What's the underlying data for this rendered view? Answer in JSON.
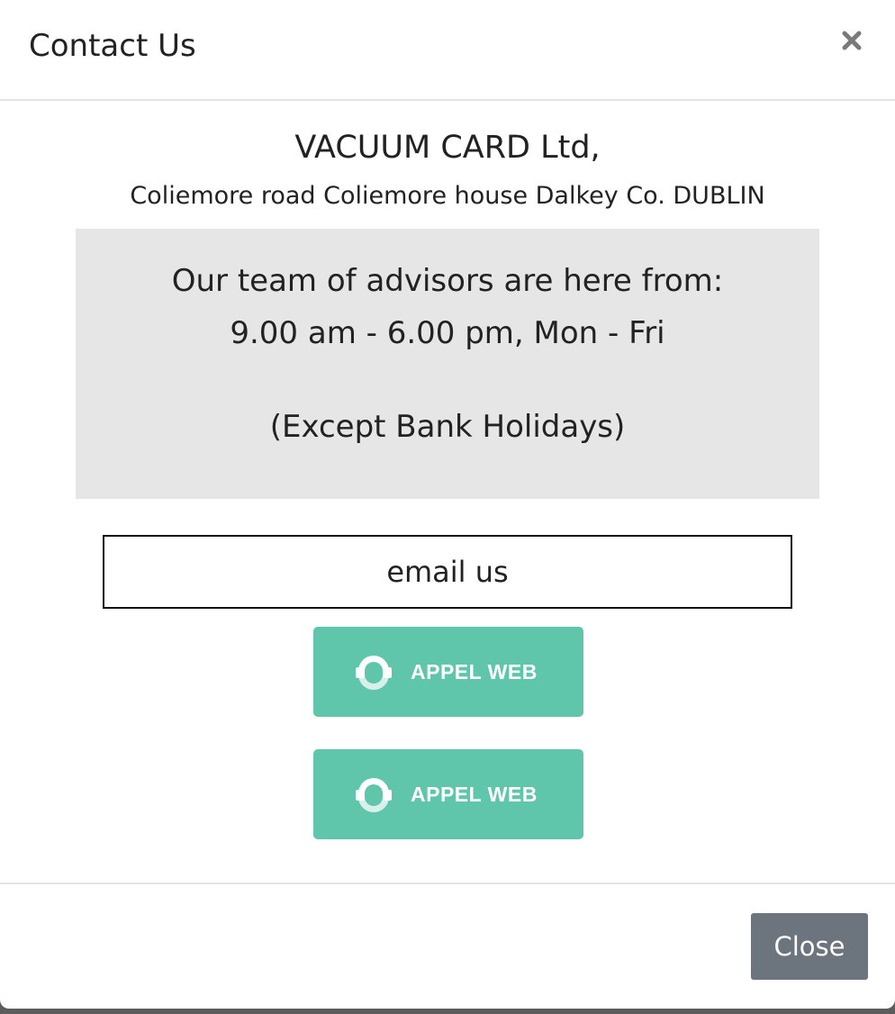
{
  "dialog": {
    "title": "Contact Us",
    "close_icon": "close-x-icon"
  },
  "company": {
    "name": "VACUUM CARD Ltd,",
    "address": "Coliemore road Coliemore house Dalkey Co. DUBLIN"
  },
  "hours": {
    "line1": "Our team of advisors are here from:",
    "line2": "9.00 am - 6.00 pm, Mon - Fri",
    "line3": "(Except Bank Holidays)"
  },
  "actions": {
    "email_label": "email us",
    "appel_buttons": [
      {
        "label": "APPEL WEB",
        "icon": "phone-call-icon"
      },
      {
        "label": "APPEL WEB",
        "icon": "phone-call-icon"
      }
    ],
    "close_label": "Close"
  },
  "colors": {
    "appel_green": "#5fc6ab",
    "close_gray": "#6c757d",
    "hours_bg": "#e6e6e6"
  }
}
